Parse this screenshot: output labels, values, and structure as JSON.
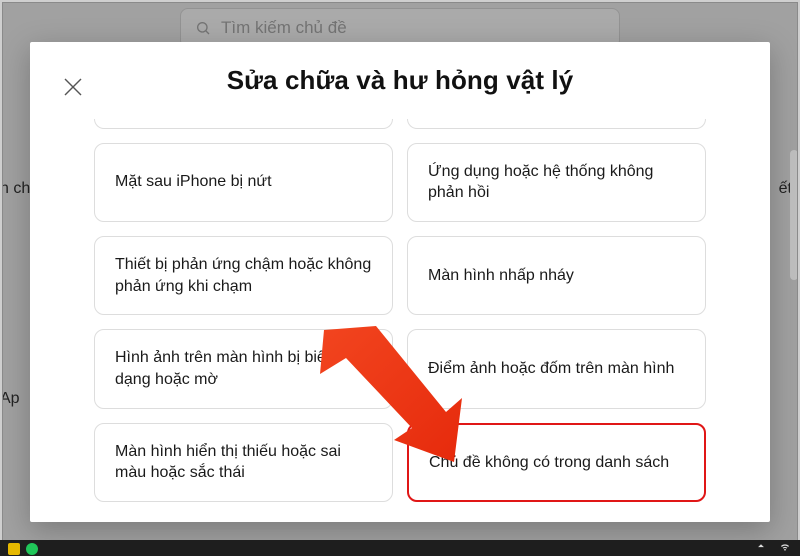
{
  "background": {
    "search_placeholder": "Tìm kiếm chủ đề",
    "left_fragment": "n ch",
    "right_fragment": "ết l",
    "left_fragment2": "Ap"
  },
  "modal": {
    "title": "Sửa chữa và hư hỏng vật lý",
    "options": [
      {
        "label": "Mặt sau iPhone bị nứt"
      },
      {
        "label": "Ứng dụng hoặc hệ thống không phản hồi"
      },
      {
        "label": "Thiết bị phản ứng chậm hoặc không phản ứng khi chạm"
      },
      {
        "label": "Màn hình nhấp nháy"
      },
      {
        "label": "Hình ảnh trên màn hình bị biến dạng hoặc mờ"
      },
      {
        "label": "Điểm ảnh hoặc đốm trên màn hình"
      },
      {
        "label": "Màn hình hiển thị thiếu hoặc sai màu hoặc sắc thái"
      },
      {
        "label": "Chủ đề không có trong danh sách"
      }
    ]
  },
  "annotation": {
    "arrow_color": "#ef3a1a",
    "highlight_color": "#e01616"
  }
}
